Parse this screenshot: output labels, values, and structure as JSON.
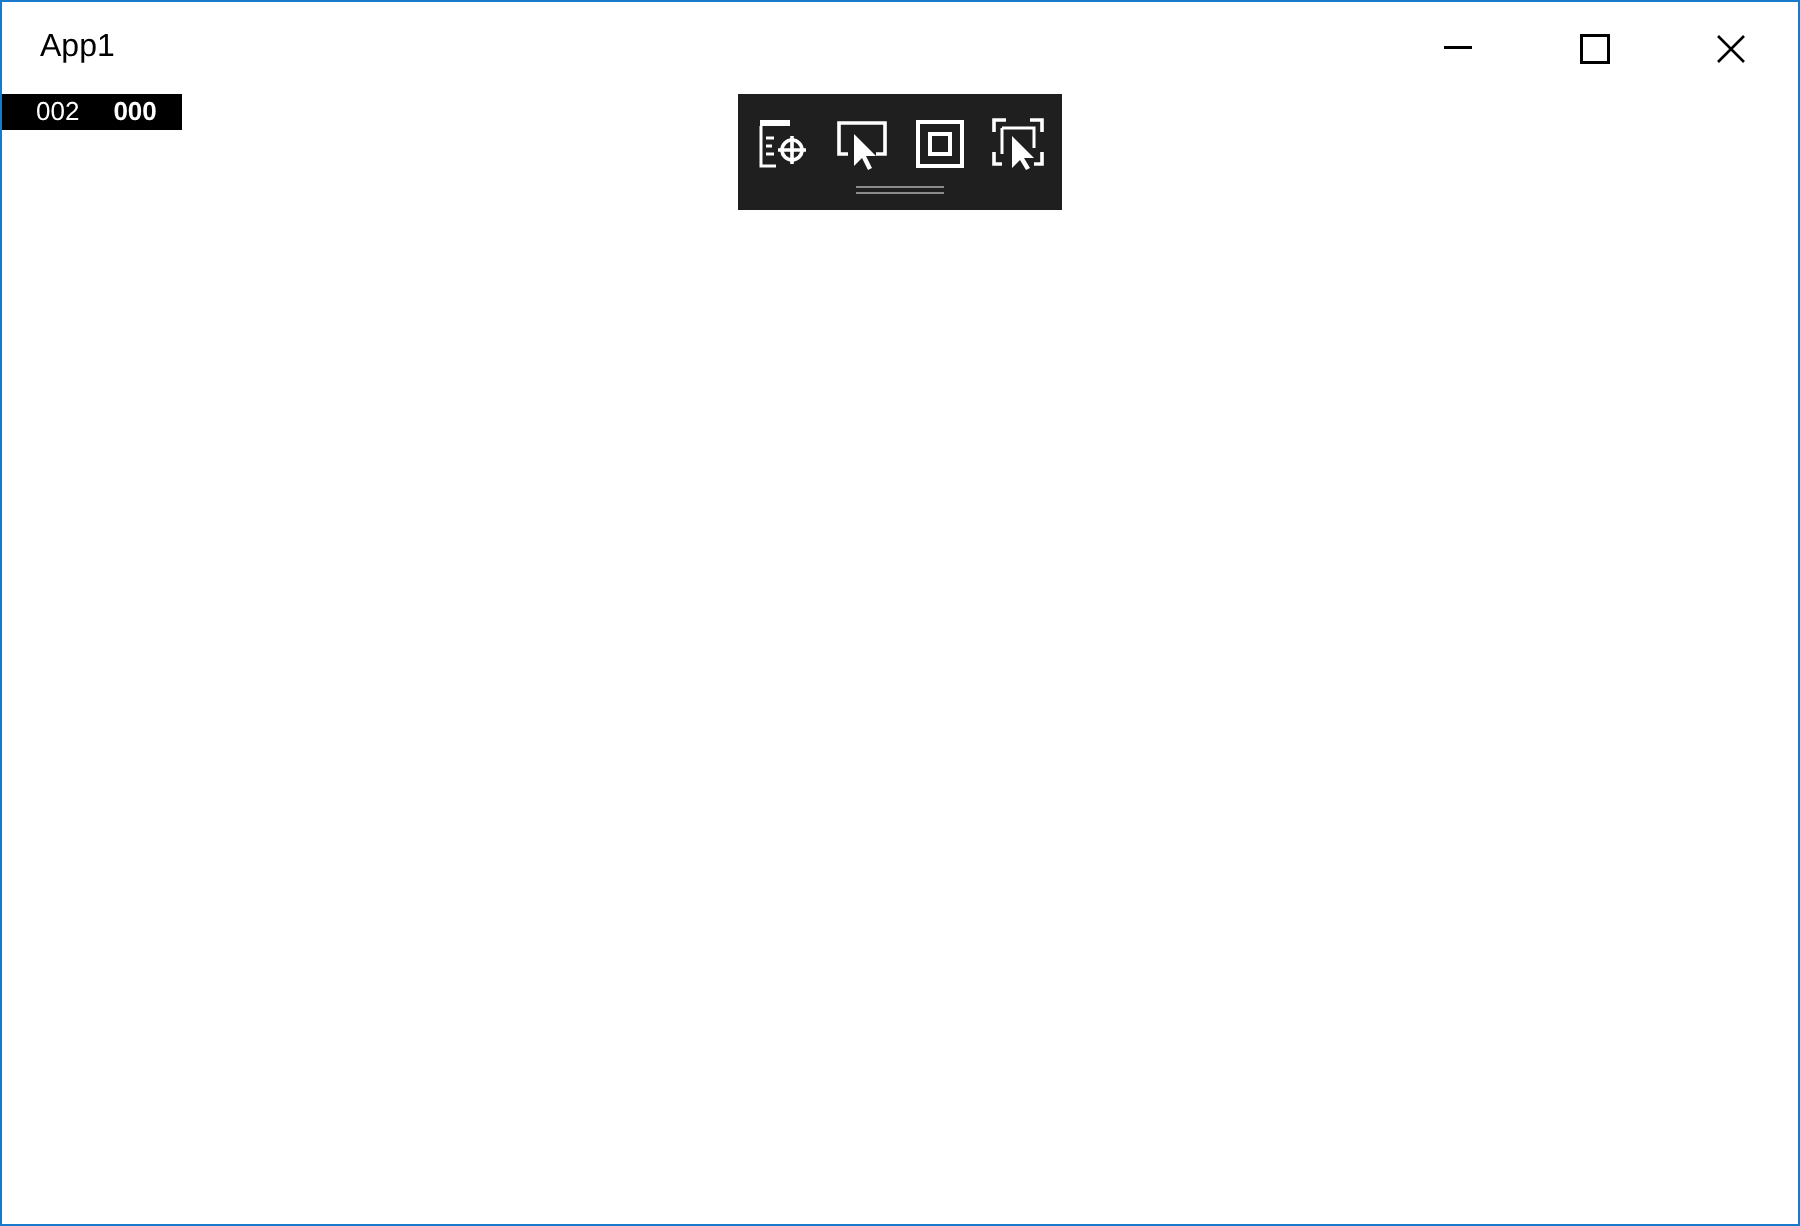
{
  "window": {
    "title": "App1"
  },
  "frame_counter": [
    "002",
    "000"
  ]
}
